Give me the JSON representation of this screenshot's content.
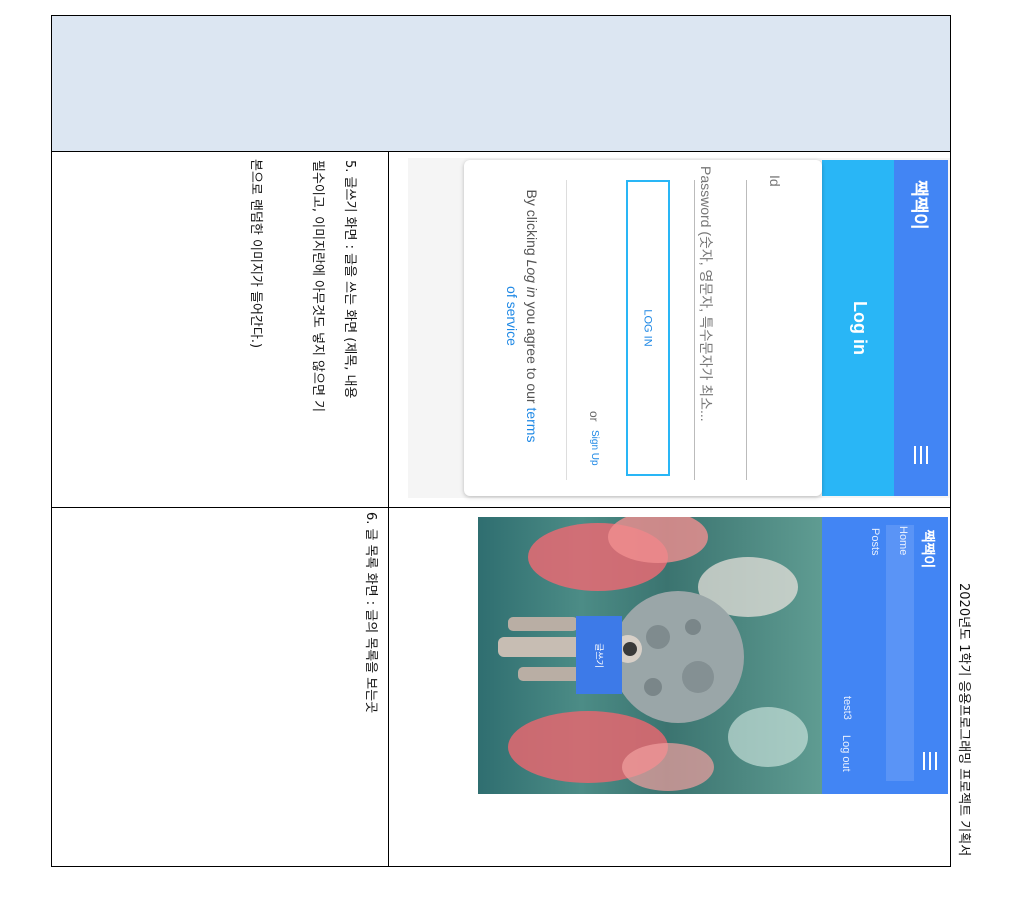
{
  "header_side": {
    "title": "2020년도 1학기 응용프로그래밍 프로젝트 기획서"
  },
  "row5": {
    "app_brand": "짹짹이",
    "login_title": "Log in",
    "id_placeholder": "Id",
    "password_placeholder": "Password (숫자, 영문자, 특수문자가 최소...",
    "login_button": "LOG IN",
    "or_text": "or",
    "signup_link": "Sign Up",
    "terms_prefix": "By clicking ",
    "terms_italic": "Log in",
    "terms_middle": " you agree to our ",
    "terms_link_1": "terms",
    "terms_link_2": "of service",
    "note_line1": "5. 글쓰기 화면 : 글을 쓰는 화면 (제목, 내용",
    "note_line2": "필수이고, 이미지란에 아무것도 넣지 않으면 기",
    "note_line3": "본으로 랜덤한 이미지가 들어간다.)"
  },
  "row6": {
    "app_brand": "짹짹이",
    "nav_home": "Home",
    "nav_posts": "Posts",
    "user_name": "test3",
    "logout": "Log out",
    "write_button": "글쓰기",
    "note_line1": "6. 글 목록 화면 : 글의 목록을 보는곳"
  },
  "colors": {
    "header_fill": "#dce6f2",
    "appbar": "#4285f4",
    "login_bar": "#29b6f6",
    "accent_link": "#1e88e5"
  }
}
